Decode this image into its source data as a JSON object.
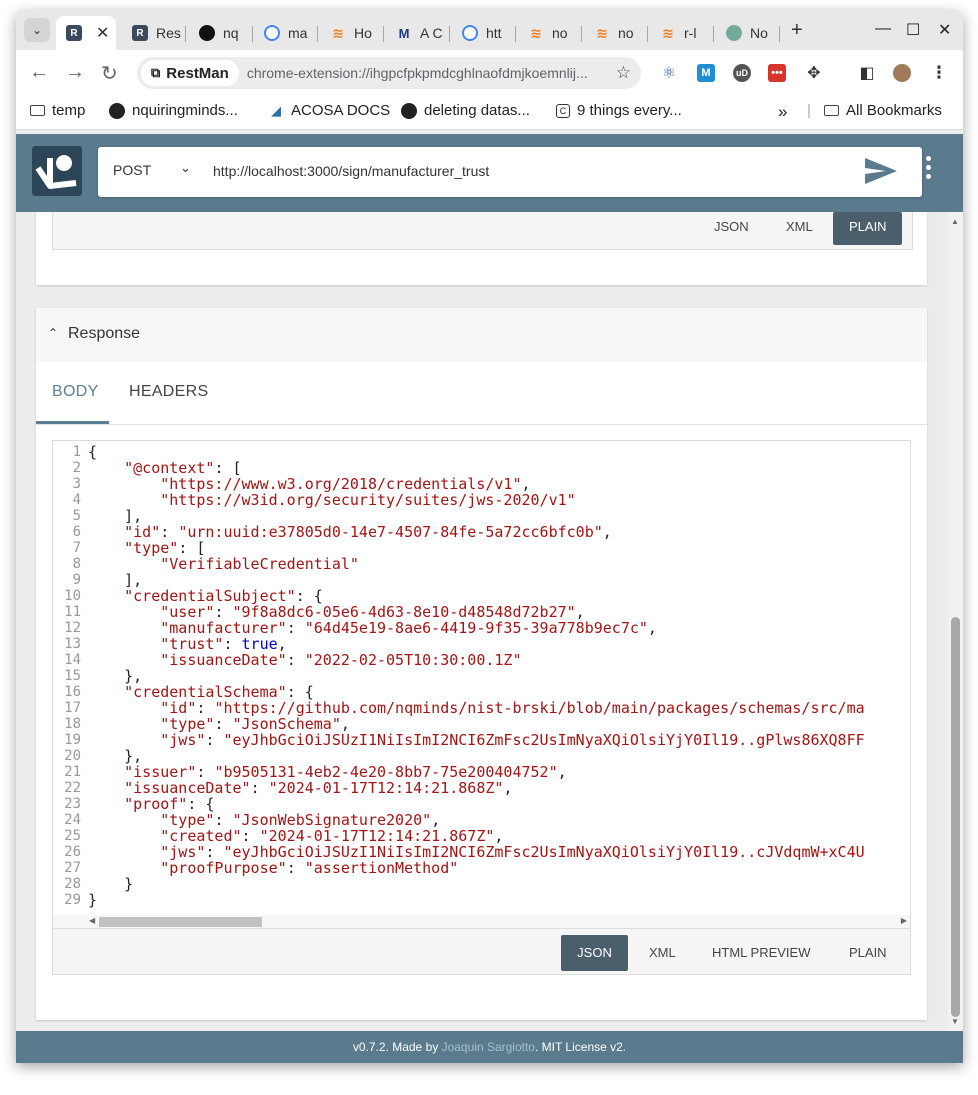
{
  "browser": {
    "tabs": [
      {
        "title": "",
        "icon": "restman-icon",
        "active": true
      },
      {
        "title": "Res",
        "icon": "restman-icon"
      },
      {
        "title": "nq",
        "icon": "github-icon"
      },
      {
        "title": "ma",
        "icon": "google-icon"
      },
      {
        "title": "Ho",
        "icon": "stackoverflow-icon"
      },
      {
        "title": "A C",
        "icon": "ma-icon"
      },
      {
        "title": "htt",
        "icon": "google-icon"
      },
      {
        "title": "no",
        "icon": "stackoverflow-icon"
      },
      {
        "title": "no",
        "icon": "stackoverflow-icon"
      },
      {
        "title": "r-l",
        "icon": "stackoverflow-icon"
      },
      {
        "title": "No",
        "icon": "chatgpt-icon"
      }
    ],
    "site_chip": "RestMan",
    "address": "chrome-extension://ihgpcfpkpmdcghlnaofdmjkoemnlij...",
    "bookmarks": {
      "temp": "temp",
      "b1": "nquiringminds...",
      "b2": "ACOSA DOCS",
      "b3": "deleting datas...",
      "b4": "9 things every...",
      "overflow": "»",
      "all": "All Bookmarks"
    }
  },
  "app": {
    "method": "POST",
    "url": "http://localhost:3000/sign/manufacturer_trust",
    "request_formats": [
      "JSON",
      "XML",
      "PLAIN"
    ],
    "response": {
      "title": "Response",
      "tabs": [
        "BODY",
        "HEADERS"
      ],
      "formats": [
        "JSON",
        "XML",
        "HTML PREVIEW",
        "PLAIN"
      ]
    },
    "footer": {
      "prefix": "v0.7.2. Made by ",
      "author": "Joaquin Sargiotto",
      "suffix": ". MIT License v2."
    }
  },
  "code_lines": [
    "{",
    "    \"@context\": [",
    "        \"https://www.w3.org/2018/credentials/v1\",",
    "        \"https://w3id.org/security/suites/jws-2020/v1\"",
    "    ],",
    "    \"id\": \"urn:uuid:e37805d0-14e7-4507-84fe-5a72cc6bfc0b\",",
    "    \"type\": [",
    "        \"VerifiableCredential\"",
    "    ],",
    "    \"credentialSubject\": {",
    "        \"user\": \"9f8a8dc6-05e6-4d63-8e10-d48548d72b27\",",
    "        \"manufacturer\": \"64d45e19-8ae6-4419-9f35-39a778b9ec7c\",",
    "        \"trust\": true,",
    "        \"issuanceDate\": \"2022-02-05T10:30:00.1Z\"",
    "    },",
    "    \"credentialSchema\": {",
    "        \"id\": \"https://github.com/nqminds/nist-brski/blob/main/packages/schemas/src/ma",
    "        \"type\": \"JsonSchema\",",
    "        \"jws\": \"eyJhbGciOiJSUzI1NiIsImI2NCI6ZmFsc2UsImNyaXQiOlsiYjY0Il19..gPlws86XQ8FF",
    "    },",
    "    \"issuer\": \"b9505131-4eb2-4e20-8bb7-75e200404752\",",
    "    \"issuanceDate\": \"2024-01-17T12:14:21.868Z\",",
    "    \"proof\": {",
    "        \"type\": \"JsonWebSignature2020\",",
    "        \"created\": \"2024-01-17T12:14:21.867Z\",",
    "        \"jws\": \"eyJhbGciOiJSUzI1NiIsImI2NCI6ZmFsc2UsImNyaXQiOlsiYjY0Il19..cJVdqmW+xC4U",
    "        \"proofPurpose\": \"assertionMethod\"",
    "    }",
    "}"
  ],
  "colors": {
    "header": "#5a7b8e",
    "accent": "#5b7f95",
    "selected_button": "#4a5e6b",
    "json_key": "#a31515",
    "json_bool": "#0000cc"
  }
}
